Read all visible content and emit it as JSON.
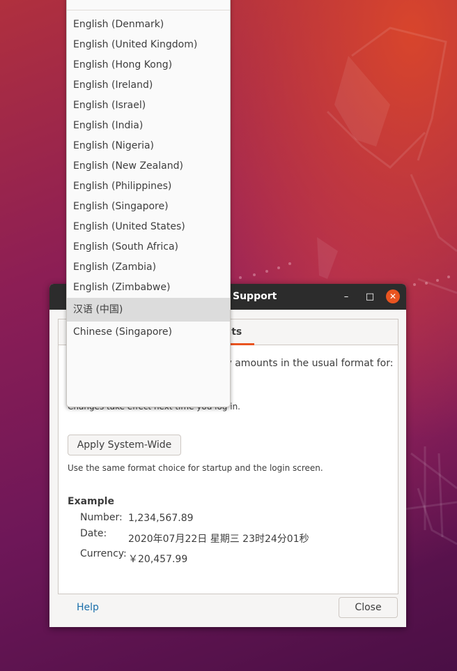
{
  "window": {
    "title": "Support",
    "controls": {
      "minimize": "–",
      "maximize": "□",
      "close": "✕"
    },
    "tab_formats": "ats",
    "prompt": "ty amounts in the usual format for:",
    "changes_note": "Changes take effect next time you log in.",
    "apply_button": "Apply System-Wide",
    "use_same_note": "Use the same format choice for startup and the login screen.",
    "example": {
      "heading": "Example",
      "number_label": "Number:",
      "number_value": "1,234,567.89",
      "date_label": "Date:",
      "date_value": "2020年07月22日 星期三 23时24分01秒",
      "currency_label": "Currency:",
      "currency_value": "￥20,457.99"
    },
    "help": "Help",
    "close_button": "Close"
  },
  "dropdown": {
    "items": [
      "English (Denmark)",
      "English (United Kingdom)",
      "English (Hong Kong)",
      "English (Ireland)",
      "English (Israel)",
      "English (India)",
      "English (Nigeria)",
      "English (New Zealand)",
      "English (Philippines)",
      "English (Singapore)",
      "English (United States)",
      "English (South Africa)",
      "English (Zambia)",
      "English (Zimbabwe)",
      "汉语 (中国)",
      "Chinese (Singapore)"
    ],
    "selected": "汉语 (中国)"
  },
  "colors": {
    "accent": "#e95420",
    "titlebar": "#2c2c2c",
    "link": "#1a6eaa"
  }
}
